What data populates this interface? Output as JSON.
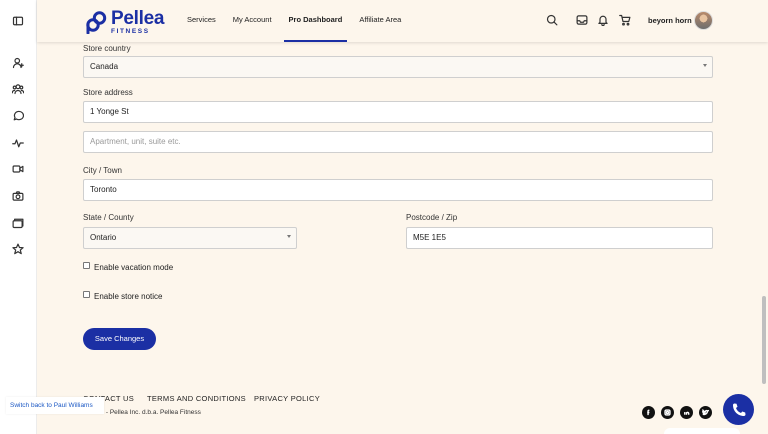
{
  "header": {
    "logo": {
      "name": "Pellea",
      "sub": "FITNESS"
    },
    "nav": [
      {
        "label": "Services",
        "active": false
      },
      {
        "label": "My Account",
        "active": false
      },
      {
        "label": "Pro Dashboard",
        "active": true
      },
      {
        "label": "Affiliate Area",
        "active": false
      }
    ],
    "icons": [
      "search-icon",
      "inbox-icon",
      "bell-icon",
      "cart-icon"
    ],
    "username": "beyorn horn"
  },
  "sidebar": {
    "icons": [
      "sidebar-toggle-icon",
      "user-add-icon",
      "users-icon",
      "chat-icon",
      "activity-icon",
      "video-icon",
      "camera-icon",
      "folders-icon",
      "star-icon"
    ]
  },
  "form": {
    "store_country": {
      "label": "Store country",
      "value": "Canada"
    },
    "store_address": {
      "label": "Store address",
      "value": "1 Yonge St",
      "line2_placeholder": "Apartment, unit, suite etc."
    },
    "city": {
      "label": "City / Town",
      "value": "Toronto"
    },
    "state": {
      "label": "State / County",
      "value": "Ontario"
    },
    "postcode": {
      "label": "Postcode / Zip",
      "value": "M5E 1E5"
    },
    "vacation_mode": {
      "label": "Enable vacation mode",
      "checked": false
    },
    "store_notice": {
      "label": "Enable store notice",
      "checked": false
    },
    "save_label": "Save Changes"
  },
  "footer": {
    "links": [
      "CONTACT US",
      "TERMS AND CONDITIONS",
      "PRIVACY POLICY"
    ],
    "copyright": "© 2024 - Pellea Inc. d.b.a. Pellea Fitness",
    "switch_back": "Switch back to Paul Williams",
    "social_icons": [
      "facebook-icon",
      "instagram-icon",
      "linkedin-icon",
      "twitter-icon"
    ]
  },
  "colors": {
    "brand": "#1b2fa4",
    "background": "#fdf6ec"
  }
}
